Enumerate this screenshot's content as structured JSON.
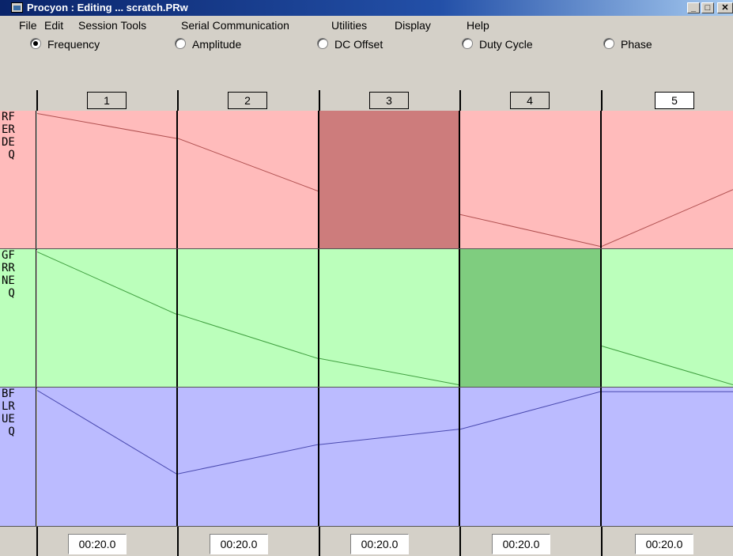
{
  "window": {
    "title": "Procyon : Editing ... scratch.PRw"
  },
  "menu": [
    "File",
    "Edit",
    "Session Tools",
    "Serial Communication",
    "Utilities",
    "Display",
    "Help"
  ],
  "modes": [
    {
      "label": "Frequency",
      "selected": true
    },
    {
      "label": "Amplitude",
      "selected": false
    },
    {
      "label": "DC Offset",
      "selected": false
    },
    {
      "label": "Duty Cycle",
      "selected": false
    },
    {
      "label": "Phase",
      "selected": false
    }
  ],
  "columns": [
    "1",
    "2",
    "3",
    "4",
    "5"
  ],
  "rows": [
    {
      "label": "RF\nER\nDE\n Q",
      "name": "red",
      "bg": "#ffbbbb",
      "active_bg": "#cd7c7c",
      "line": "#b05050",
      "active_col": 2,
      "segments": [
        [
          0.02,
          0.2
        ],
        [
          0.2,
          0.58
        ],
        null,
        [
          0.75,
          0.98
        ],
        [
          0.98,
          0.57
        ]
      ]
    },
    {
      "label": "GF\nRR\nNE\n Q",
      "name": "green",
      "bg": "#bbffbb",
      "active_bg": "#7fcd7f",
      "line": "#40a040",
      "active_col": 3,
      "segments": [
        [
          0.02,
          0.47
        ],
        [
          0.47,
          0.79
        ],
        [
          0.79,
          0.98
        ],
        null,
        [
          0.7,
          0.98
        ]
      ]
    },
    {
      "label": "BF\nLR\nUE\n Q",
      "name": "blue",
      "bg": "#bbbbff",
      "active_bg": "#9a9aee",
      "line": "#4a4ab0",
      "active_col": -1,
      "segments": [
        [
          0.02,
          0.62
        ],
        [
          0.62,
          0.41
        ],
        [
          0.41,
          0.3
        ],
        [
          0.3,
          0.03
        ],
        [
          0.03,
          0.03
        ]
      ]
    }
  ],
  "durations": [
    "00:20.0",
    "00:20.0",
    "00:20.0",
    "00:20.0",
    "00:20.0"
  ]
}
